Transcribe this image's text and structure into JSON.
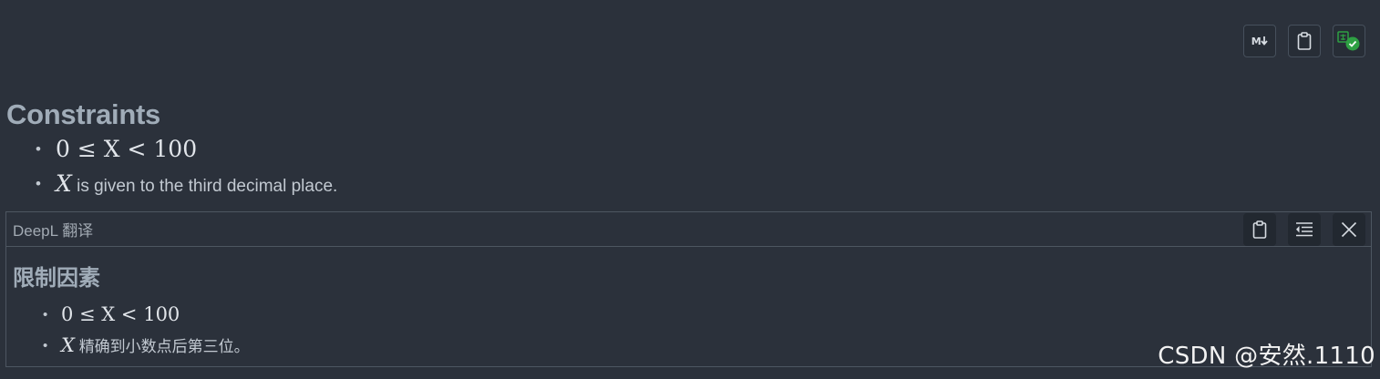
{
  "toolbar": {
    "buttons": [
      {
        "label": "M",
        "icon": "markdown-download-icon"
      },
      {
        "icon": "clipboard-icon"
      },
      {
        "icon": "translate-check-icon"
      }
    ]
  },
  "section": {
    "title": "Constraints",
    "items": [
      {
        "math": "0 ≤ X < 100",
        "text": ""
      },
      {
        "math": "X",
        "text": "is given to the third decimal place."
      }
    ]
  },
  "translation": {
    "header": "DeepL 翻译",
    "actions": [
      {
        "icon": "clipboard-icon"
      },
      {
        "icon": "indent-list-icon"
      },
      {
        "icon": "close-icon"
      }
    ],
    "title": "限制因素",
    "items": [
      {
        "math": "0 ≤ X < 100",
        "text": ""
      },
      {
        "math": "X",
        "text": "精确到小数点后第三位。"
      }
    ]
  },
  "watermark": "CSDN @安然.1110",
  "colors": {
    "background": "#2b313b",
    "heading": "#a0acb8",
    "text": "#c2c9d1",
    "check_green": "#2ea043"
  }
}
